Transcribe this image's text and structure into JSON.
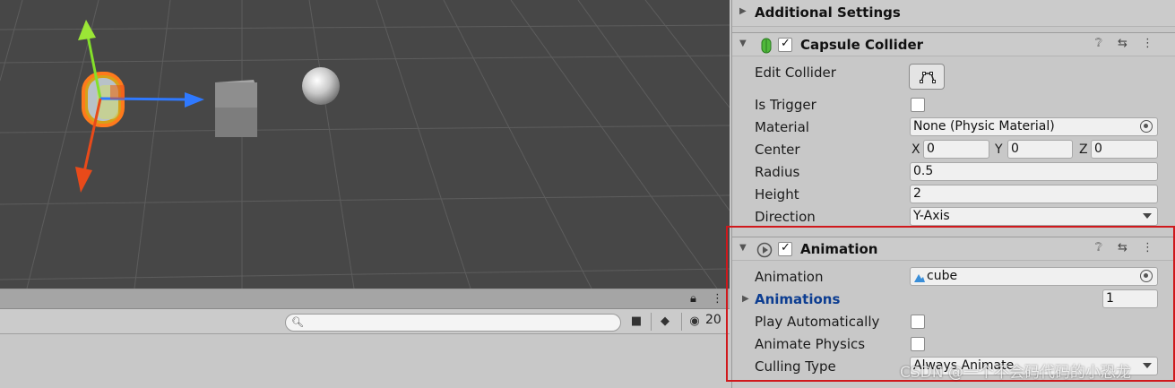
{
  "inspector": {
    "additional_settings": {
      "title": "Additional Settings"
    },
    "capsule_collider": {
      "title": "Capsule Collider",
      "enabled": true,
      "edit_collider_label": "Edit Collider",
      "is_trigger_label": "Is Trigger",
      "material_label": "Material",
      "material_value": "None (Physic Material)",
      "center_label": "Center",
      "center": {
        "x_label": "X",
        "x": "0",
        "y_label": "Y",
        "y": "0",
        "z_label": "Z",
        "z": "0"
      },
      "radius_label": "Radius",
      "radius": "0.5",
      "height_label": "Height",
      "height": "2",
      "direction_label": "Direction",
      "direction_value": "Y-Axis"
    },
    "animation": {
      "title": "Animation",
      "enabled": true,
      "animation_label": "Animation",
      "animation_value": "cube",
      "animations_label": "Animations",
      "animations_count": "1",
      "play_automatically_label": "Play Automatically",
      "animate_physics_label": "Animate Physics",
      "culling_type_label": "Culling Type",
      "culling_type_value": "Always Animate"
    }
  },
  "bottom_panel": {
    "search_placeholder": "",
    "hidden_count": "20"
  },
  "watermark": "CSDN @一个不会码代码的小恐龙",
  "colors": {
    "highlight": "#d0181c",
    "link_blue": "#0c3d91",
    "scene_bg": "#474747"
  },
  "icons": {
    "capsule_collider": "capsule-collider-icon",
    "animation": "animation-icon",
    "help": "help-icon",
    "presets": "presets-icon",
    "menu": "kebab-menu-icon"
  }
}
